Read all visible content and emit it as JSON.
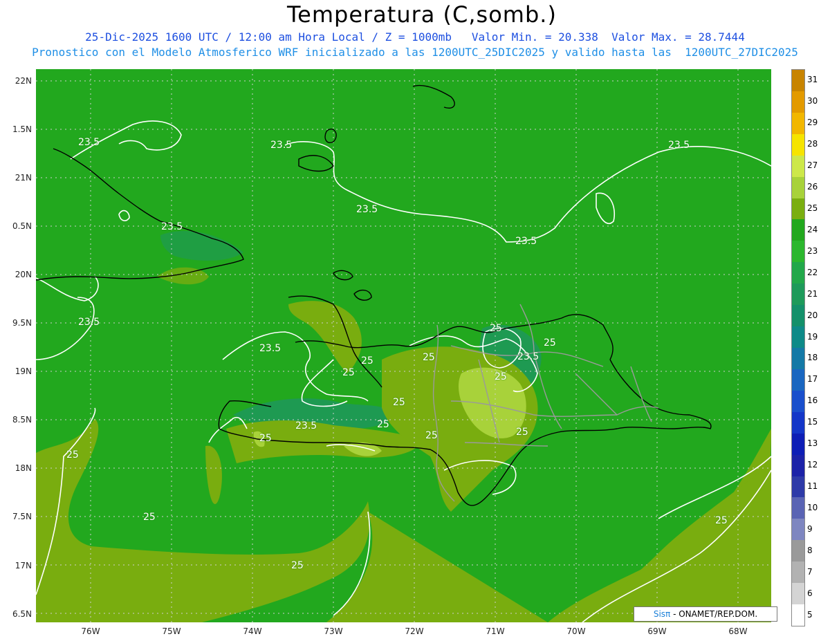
{
  "header": {
    "title": "Temperatura (C,somb.)",
    "line1": "25-Dic-2025 1600 UTC / 12:00 am Hora Local / Z = 1000mb   Valor Min. = 20.338  Valor Max. = 28.7444",
    "line2": "Pronostico con el Modelo Atmosferico WRF inicializado a las 1200UTC_25DIC2025 y valido hasta las  1200UTC_27DIC2025"
  },
  "axes": {
    "lat_labels": [
      "22N",
      "1.5N",
      "21N",
      "0.5N",
      "20N",
      "9.5N",
      "19N",
      "8.5N",
      "18N",
      "7.5N",
      "17N",
      "6.5N"
    ],
    "lon_labels": [
      "76W",
      "75W",
      "74W",
      "73W",
      "72W",
      "71W",
      "70W",
      "69W",
      "68W"
    ]
  },
  "colorbar": {
    "labels": [
      "31",
      "30",
      "29",
      "28",
      "27",
      "26",
      "25",
      "24",
      "23",
      "22",
      "21",
      "20",
      "19",
      "18",
      "17",
      "16",
      "15",
      "13",
      "12",
      "11",
      "10",
      "9",
      "8",
      "7",
      "6",
      "5"
    ],
    "colors": [
      "#c88400",
      "#e39a00",
      "#f2b700",
      "#f6e400",
      "#cde84a",
      "#a8d23a",
      "#7aae10",
      "#22a81e",
      "#2cb72e",
      "#22a84a",
      "#1e9a5a",
      "#14906a",
      "#0e8a88",
      "#1479a6",
      "#1a66c0",
      "#1a4fcc",
      "#1436c8",
      "#0e1eb6",
      "#1c22a8",
      "#2e3aa8",
      "#5a64b4",
      "#7e86c0",
      "#9a9a9a",
      "#b2b2b2",
      "#d4d4d4",
      "#ffffff"
    ]
  },
  "contour_labels": [
    "23.5",
    "23.5",
    "23.5",
    "23.5",
    "23.5",
    "23.5",
    "23.5",
    "23.5",
    "23.5",
    "23.5",
    "25",
    "25",
    "25",
    "25",
    "25",
    "25",
    "25",
    "25",
    "25",
    "25",
    "25",
    "25",
    "25",
    "25",
    "25"
  ],
  "credit": {
    "brand": "Sisπ",
    "text": " - ONAMET/REP.DOM."
  },
  "colors": {
    "sea_warm": "#79ad0f",
    "field_main": "#22a81e",
    "field_cool": "#1e9a52",
    "land_hot": "#a8d23a",
    "coast": "#000000",
    "borders": "#9a9a9a",
    "contour": "#ffffff",
    "grid": "#cfcfcf"
  }
}
